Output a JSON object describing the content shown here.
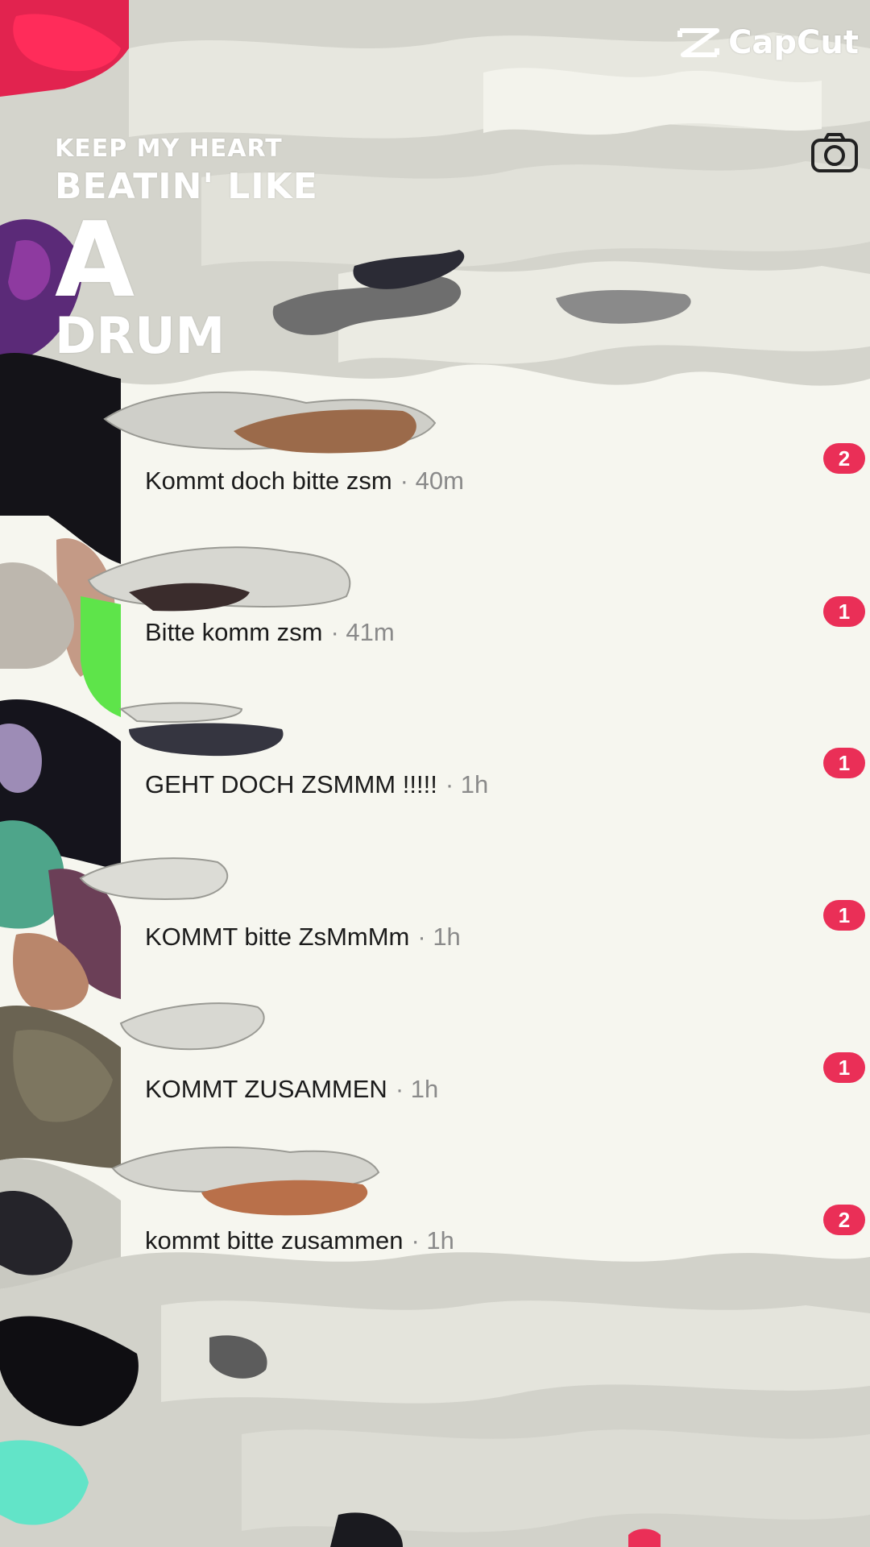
{
  "watermark": {
    "brand": "CapCut"
  },
  "overlay_title": {
    "line1": "KEEP MY HEART",
    "line2": "BEATIN' LIKE",
    "line3": "A",
    "line4": "DRUM"
  },
  "header": {
    "camera_icon": "camera-icon"
  },
  "messages": [
    {
      "text": "Kommt doch bitte zsm",
      "time": "40m",
      "unread": "2"
    },
    {
      "text": "Bitte komm zsm",
      "time": "41m",
      "unread": "1"
    },
    {
      "text": "GEHT DOCH ZSMMM !!!!!",
      "time": "1h",
      "unread": "1"
    },
    {
      "text": "KOMMT bitte ZsMmMm",
      "time": "1h",
      "unread": "1"
    },
    {
      "text": "KOMMT ZUSAMMEN",
      "time": "1h",
      "unread": "1"
    },
    {
      "text": "kommt bitte zusammen",
      "time": "1h",
      "unread": "2"
    }
  ],
  "colors": {
    "badge": "#ea2f57",
    "brush_grey": "#c8c8c0",
    "paper": "#f4f4ee"
  }
}
